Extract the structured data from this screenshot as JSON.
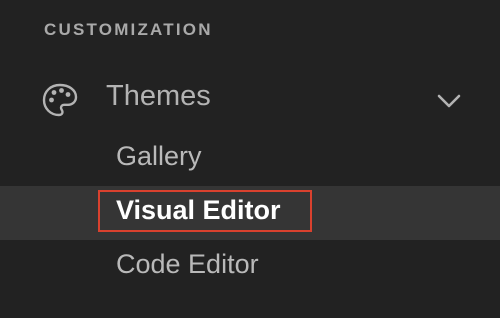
{
  "sidebar": {
    "section_title": "CUSTOMIZATION",
    "group": {
      "label": "Themes",
      "icon": "palette-icon",
      "toggle_icon": "chevron-down-icon",
      "expanded": true,
      "items": [
        {
          "label": "Gallery",
          "active": false
        },
        {
          "label": "Visual Editor",
          "active": true
        },
        {
          "label": "Code Editor",
          "active": false
        }
      ]
    }
  },
  "colors": {
    "background": "#222222",
    "active_row": "#353535",
    "highlight_border": "#d9412e",
    "text_muted": "#a9a9a9",
    "text_active": "#ffffff"
  }
}
